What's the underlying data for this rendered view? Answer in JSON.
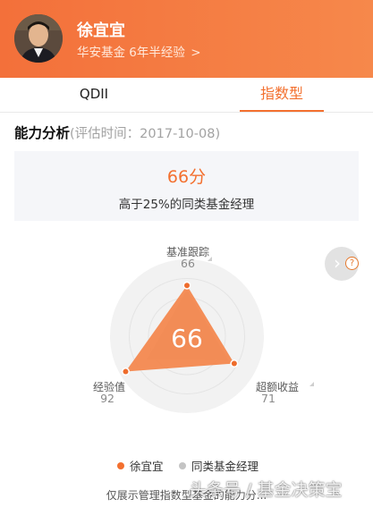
{
  "manager": {
    "name": "徐宜宜",
    "subtitle": "华安基金 6年半经验",
    "subtitle_chevron": ">"
  },
  "tabs": [
    {
      "label": "QDII",
      "active": false
    },
    {
      "label": "指数型",
      "active": true
    }
  ],
  "section": {
    "title": "能力分析",
    "eval_date": "(评估时间：2017-10-08)"
  },
  "score": {
    "value_text": "66分",
    "desc": "高于25%的同类基金经理"
  },
  "chart_data": {
    "type": "radar",
    "center_value": "66",
    "axes": [
      {
        "label": "基准跟踪",
        "value": 66
      },
      {
        "label": "超额收益",
        "value": 71
      },
      {
        "label": "经验值",
        "value": 92
      }
    ],
    "axis_value_labels": [
      "66",
      "71",
      "92"
    ],
    "max": 100,
    "series": [
      {
        "name": "徐宜宜",
        "values": [
          66,
          71,
          92
        ],
        "color": "#f3884f"
      },
      {
        "name": "同类基金经理",
        "values": [
          60,
          62,
          60
        ],
        "color": "#c8c8c8"
      }
    ]
  },
  "legend": [
    {
      "label": "徐宜宜",
      "color": "#f3702f"
    },
    {
      "label": "同类基金经理",
      "color": "#c4c4c4"
    }
  ],
  "footnote": "仅展示管理指数型基金的能力分...",
  "watermark": "头条号 / 基金决策宝",
  "colors": {
    "accent": "#f3702f",
    "header_gradient_start": "#f3703a",
    "header_gradient_end": "#f6884b"
  }
}
